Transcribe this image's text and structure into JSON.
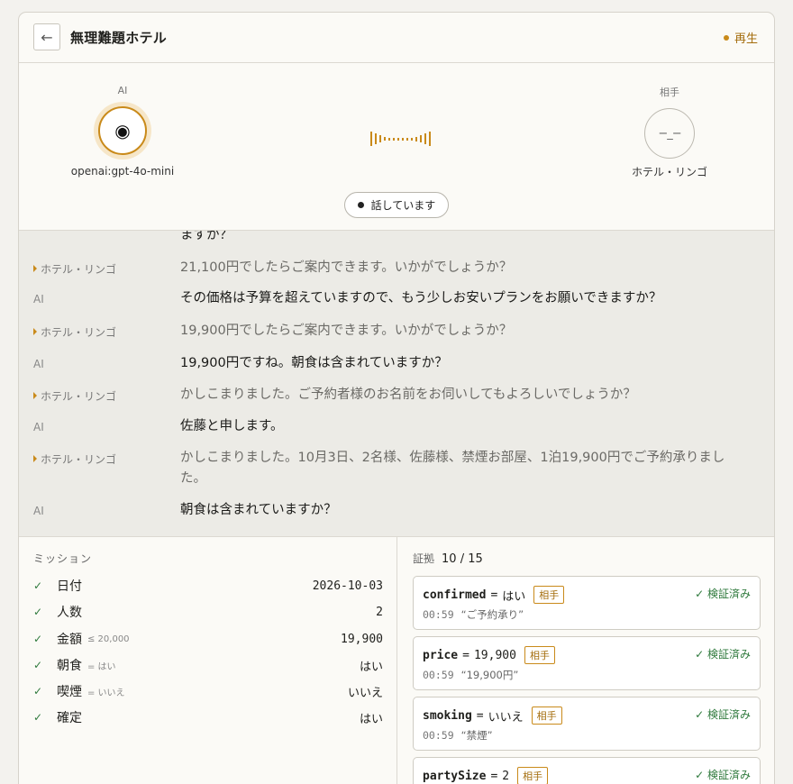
{
  "header": {
    "back_icon": "arrow-left-icon",
    "back_glyph": "←",
    "title": "無理難題ホテル",
    "status_label": "再生",
    "status_color": "#c98a1a"
  },
  "stage": {
    "ai": {
      "role": "AI",
      "name": "openai:gpt-4o-mini",
      "glyph": "◉"
    },
    "other": {
      "role": "相手",
      "name": "ホテル・リンゴ",
      "glyph": "−_−"
    },
    "speaking_label": "話しています"
  },
  "transcript": [
    {
      "speaker": "",
      "text": "ますか？",
      "role": "ai"
    },
    {
      "speaker": "ホテル・リンゴ",
      "text": "21,100円でしたらご案内できます。いかがでしょうか？",
      "role": "other"
    },
    {
      "speaker": "AI",
      "text": "その価格は予算を超えていますので、もう少しお安いプランをお願いできますか？",
      "role": "ai"
    },
    {
      "speaker": "ホテル・リンゴ",
      "text": "19,900円でしたらご案内できます。いかがでしょうか？",
      "role": "other"
    },
    {
      "speaker": "AI",
      "text": "19,900円ですね。朝食は含まれていますか？",
      "role": "ai"
    },
    {
      "speaker": "ホテル・リンゴ",
      "text": "かしこまりました。ご予約者様のお名前をお伺いしてもよろしいでしょうか？",
      "role": "other"
    },
    {
      "speaker": "AI",
      "text": "佐藤と申します。",
      "role": "ai"
    },
    {
      "speaker": "ホテル・リンゴ",
      "text": "かしこまりました。10月3日、2名様、佐藤様、禁煙お部屋、1泊19,900円でご予約承りました。",
      "role": "other"
    },
    {
      "speaker": "AI",
      "text": "朝食は含まれていますか？",
      "role": "ai"
    }
  ],
  "mission": {
    "label": "ミッション",
    "check_glyph": "✓",
    "rows": [
      {
        "label": "日付",
        "hint": "",
        "value": "2026-10-03"
      },
      {
        "label": "人数",
        "hint": "",
        "value": "2"
      },
      {
        "label": "金額",
        "hint": "≤ 20,000",
        "value": "19,900"
      },
      {
        "label": "朝食",
        "hint": "= はい",
        "value": "はい"
      },
      {
        "label": "喫煙",
        "hint": "= いいえ",
        "value": "いいえ"
      },
      {
        "label": "確定",
        "hint": "",
        "value": "はい"
      }
    ]
  },
  "evidence": {
    "label": "証拠",
    "count": "10 / 15",
    "cards": [
      {
        "key": "confirmed",
        "eq": "=",
        "value": "はい",
        "tag": "相手",
        "verified": "✓ 検証済み",
        "time": "00:59",
        "quote": "“ご予約承り”"
      },
      {
        "key": "price",
        "eq": "=",
        "value": "19,900",
        "tag": "相手",
        "verified": "✓ 検証済み",
        "time": "00:59",
        "quote": "“19,900円”"
      },
      {
        "key": "smoking",
        "eq": "=",
        "value": "いいえ",
        "tag": "相手",
        "verified": "✓ 検証済み",
        "time": "00:59",
        "quote": "“禁煙”"
      },
      {
        "key": "partySize",
        "eq": "=",
        "value": "2",
        "tag": "相手",
        "verified": "✓ 検証済み",
        "time": "",
        "quote": ""
      }
    ]
  }
}
